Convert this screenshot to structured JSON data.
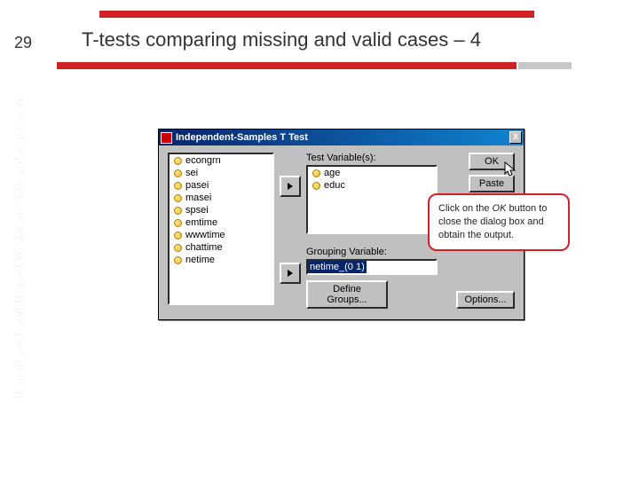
{
  "slide": {
    "number": "29",
    "title": "T-tests comparing missing and valid cases – 4"
  },
  "bgtext": "H₁:μ<0   y=(1−s)θ   H₀:μ=0   W=Σwᵢ   σ²=E(x−μ)²   z=μ   t=s/√n",
  "dialog": {
    "title": "Independent-Samples T Test",
    "closeLabel": "X",
    "sourceVars": [
      "econgrn",
      "sei",
      "pasei",
      "masei",
      "spsei",
      "emtime",
      "wwwtime",
      "chattime",
      "netime"
    ],
    "testVarsLabel": "Test Variable(s):",
    "testVars": [
      "age",
      "educ"
    ],
    "groupingLabel": "Grouping Variable:",
    "groupingValue": "netime_(0 1)",
    "defineLabel": "Define Groups...",
    "okLabel": "OK",
    "pasteLabel": "Paste",
    "optionsLabel": "Options..."
  },
  "callout": {
    "line1": "Click on the ",
    "em": "OK",
    "line2": " button to close the dialog box and obtain the output."
  }
}
